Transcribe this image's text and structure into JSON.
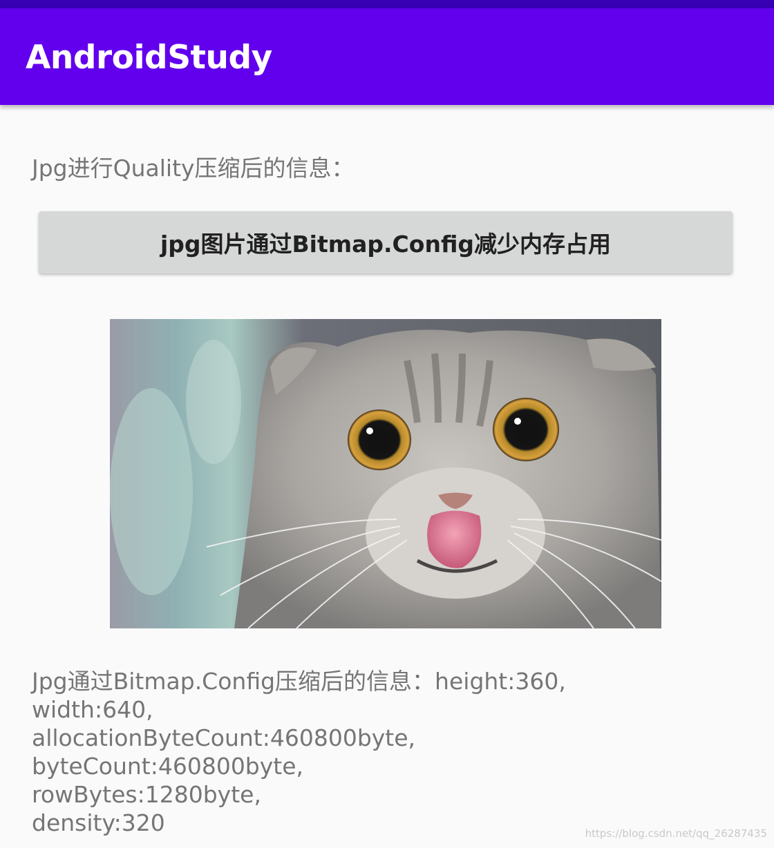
{
  "app_bar": {
    "title": "AndroidStudy",
    "color": "#6200ee",
    "status_bar_color": "#3700b3"
  },
  "quality_info": {
    "text": "Jpg进行Quality压缩后的信息："
  },
  "reduce_button": {
    "label": "jpg图片通过Bitmap.Config减少内存占用"
  },
  "image": {
    "subject": "cat-photo"
  },
  "config_info": {
    "lines": [
      "Jpg通过Bitmap.Config压缩后的信息：height:360,",
      "width:640,",
      "allocationByteCount:460800byte,",
      "byteCount:460800byte,",
      "rowBytes:1280byte,",
      "density:320"
    ]
  },
  "watermark": {
    "text": "https://blog.csdn.net/qq_26287435"
  }
}
